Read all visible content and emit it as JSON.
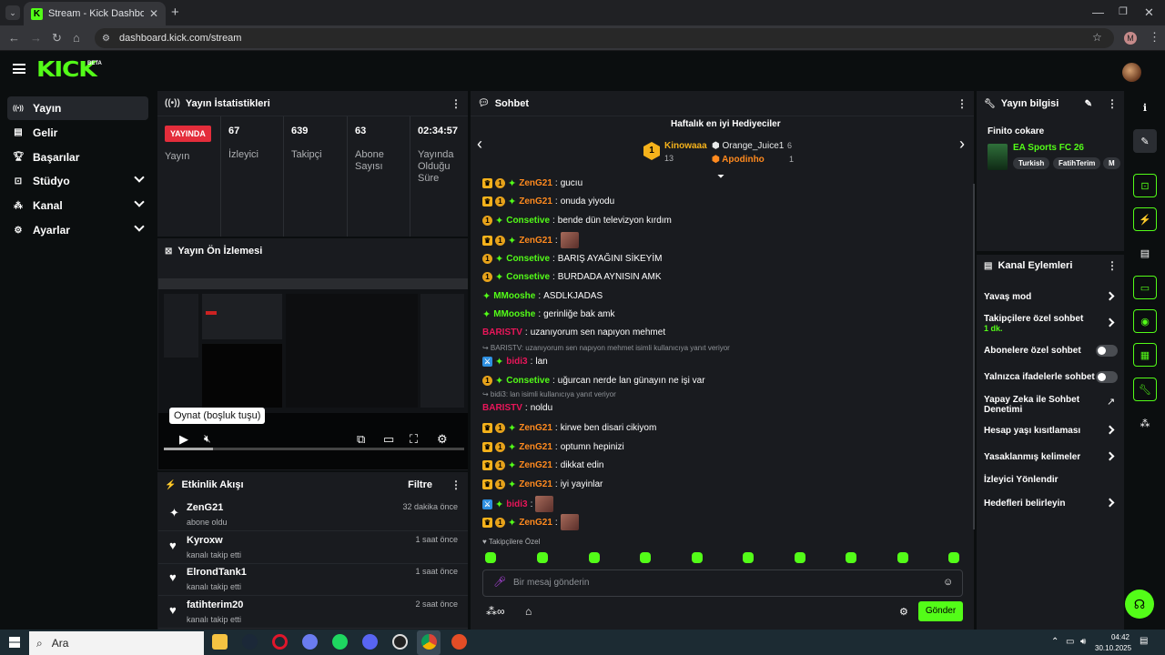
{
  "browser": {
    "tab_title": "Stream - Kick Dashboard",
    "url": "dashboard.kick.com/stream",
    "profile_initial": "M"
  },
  "header": {
    "logo": "KICK",
    "beta": "BETA"
  },
  "sidebar": {
    "items": [
      {
        "label": "Yayın",
        "icon": "broadcast-icon",
        "active": true,
        "expandable": false
      },
      {
        "label": "Gelir",
        "icon": "revenue-icon",
        "active": false,
        "expandable": false
      },
      {
        "label": "Başarılar",
        "icon": "trophy-icon",
        "active": false,
        "expandable": false
      },
      {
        "label": "Stüdyo",
        "icon": "studio-icon",
        "active": false,
        "expandable": true
      },
      {
        "label": "Kanal",
        "icon": "channel-icon",
        "active": false,
        "expandable": true
      },
      {
        "label": "Ayarlar",
        "icon": "settings-icon",
        "active": false,
        "expandable": true
      }
    ]
  },
  "stats": {
    "title": "Yayın İstatistikleri",
    "live_label": "YAYINDA",
    "live_sub": "Yayın",
    "items": [
      {
        "value": "67",
        "label": "İzleyici"
      },
      {
        "value": "639",
        "label": "Takipçi"
      },
      {
        "value": "63",
        "label": "Abone Sayısı"
      },
      {
        "value": "02:34:57",
        "label": "Yayında Olduğu Süre"
      }
    ]
  },
  "preview": {
    "title": "Yayın Ön İzlemesi",
    "tooltip": "Oynat (boşluk tuşu)"
  },
  "events": {
    "title": "Etkinlik Akışı",
    "filter": "Filtre",
    "items": [
      {
        "name": "ZenG21",
        "sub": "abone oldu",
        "time": "32 dakika önce",
        "icon": "sparkle-icon"
      },
      {
        "name": "Kyroxw",
        "sub": "kanalı takip etti",
        "time": "1 saat önce",
        "icon": "heart-icon"
      },
      {
        "name": "ElrondTank1",
        "sub": "kanalı takip etti",
        "time": "1 saat önce",
        "icon": "heart-icon"
      },
      {
        "name": "fatihterim20",
        "sub": "kanalı takip etti",
        "time": "2 saat önce",
        "icon": "heart-icon"
      }
    ]
  },
  "chat": {
    "title": "Sohbet",
    "gifters_title": "Haftalık en iyi Hediyeciler",
    "gifters": [
      {
        "rank": "1",
        "name": "Kinowaaa",
        "count": "13"
      },
      {
        "name": "Orange_Juice1",
        "count": "6"
      },
      {
        "name": "Apodinho",
        "count": "1"
      }
    ],
    "messages": [
      {
        "badges": [
          "crown",
          "sub",
          "spark"
        ],
        "user": "ZenG21",
        "color": "#ff8a1f",
        "text": "gucıu",
        "cut": true
      },
      {
        "badges": [
          "crown",
          "sub",
          "spark"
        ],
        "user": "ZenG21",
        "color": "#ff8a1f",
        "text": "onuda yiyodu"
      },
      {
        "badges": [
          "sub",
          "spark"
        ],
        "user": "Consetive",
        "color": "#53fc18",
        "text": "bende dün televizyon kırdım"
      },
      {
        "badges": [
          "crown",
          "sub",
          "spark"
        ],
        "user": "ZenG21",
        "color": "#ff8a1f",
        "text": "",
        "emote": true
      },
      {
        "badges": [
          "sub",
          "spark"
        ],
        "user": "Consetive",
        "color": "#53fc18",
        "text": "BARIŞ AYAĞINI SİKEYİM"
      },
      {
        "badges": [
          "sub",
          "spark"
        ],
        "user": "Consetive",
        "color": "#53fc18",
        "text": "BURDADA AYNISIN AMK"
      },
      {
        "badges": [
          "spark"
        ],
        "user": "MMooshe",
        "color": "#53fc18",
        "text": "ASDLKJADAS"
      },
      {
        "badges": [
          "spark"
        ],
        "user": "MMooshe",
        "color": "#53fc18",
        "text": "gerinliğe bak amk"
      },
      {
        "badges": [],
        "user": "BARISTV",
        "color": "#e9165a",
        "text": "uzanıyorum sen napıyon mehmet"
      },
      {
        "reply": "↪ BARISTV: uzanıyorum sen napıyon mehmet isimli kullanıcıya yanıt veriyor"
      },
      {
        "badges": [
          "mod",
          "spark"
        ],
        "user": "bidi3",
        "color": "#e9165a",
        "text": "lan"
      },
      {
        "badges": [
          "sub",
          "spark"
        ],
        "user": "Consetive",
        "color": "#53fc18",
        "text": "uğurcan nerde lan günayın ne işi var"
      },
      {
        "reply": "↪ bidi3: lan isimli kullanıcıya yanıt veriyor"
      },
      {
        "badges": [],
        "user": "BARISTV",
        "color": "#e9165a",
        "text": "noldu"
      },
      {
        "badges": [
          "crown",
          "sub",
          "spark"
        ],
        "user": "ZenG21",
        "color": "#ff8a1f",
        "text": "kirwe ben disari cikiyom"
      },
      {
        "badges": [
          "crown",
          "sub",
          "spark"
        ],
        "user": "ZenG21",
        "color": "#ff8a1f",
        "text": "optumn hepinizi"
      },
      {
        "badges": [
          "crown",
          "sub",
          "spark"
        ],
        "user": "ZenG21",
        "color": "#ff8a1f",
        "text": "dikkat edin"
      },
      {
        "badges": [
          "crown",
          "sub",
          "spark"
        ],
        "user": "ZenG21",
        "color": "#ff8a1f",
        "text": "iyi yayinlar"
      },
      {
        "badges": [
          "mod",
          "spark"
        ],
        "user": "bidi3",
        "color": "#e9165a",
        "text": "",
        "emote": true
      },
      {
        "badges": [
          "crown",
          "sub",
          "spark"
        ],
        "user": "ZenG21",
        "color": "#ff8a1f",
        "text": "",
        "emote": true
      }
    ],
    "mode": "Takipçilere Özel",
    "placeholder": "Bir mesaj gönderin",
    "send": "Gönder"
  },
  "info": {
    "title": "Yayın bilgisi",
    "stream_title": "Finito cokare",
    "category": "EA Sports FC 26",
    "tags": [
      "Turkish",
      "FatihTerim",
      "M"
    ]
  },
  "actions": {
    "title": "Kanal Eylemleri",
    "items": [
      {
        "label": "Yavaş mod",
        "type": "chevron"
      },
      {
        "label": "Takipçilere özel sohbet",
        "sub": "1 dk.",
        "type": "chevron"
      },
      {
        "label": "Abonelere özel sohbet",
        "type": "toggle"
      },
      {
        "label": "Yalnızca ifadelerle sohbet",
        "type": "toggle"
      },
      {
        "label": "Yapay Zeka ile Sohbet Denetimi",
        "type": "external"
      },
      {
        "label": "Hesap yaşı kısıtlaması",
        "type": "chevron"
      },
      {
        "label": "Yasaklanmış kelimeler",
        "type": "chevron"
      },
      {
        "label": "İzleyici Yönlendir",
        "type": "none"
      },
      {
        "label": "Hedefleri belirleyin",
        "type": "chevron"
      }
    ]
  },
  "taskbar": {
    "search": "Ara",
    "time": "04:42",
    "date": "30.10.2025"
  },
  "colors": {
    "accent": "#53fc18",
    "live": "#e42d3b",
    "panel": "#191b1f"
  }
}
